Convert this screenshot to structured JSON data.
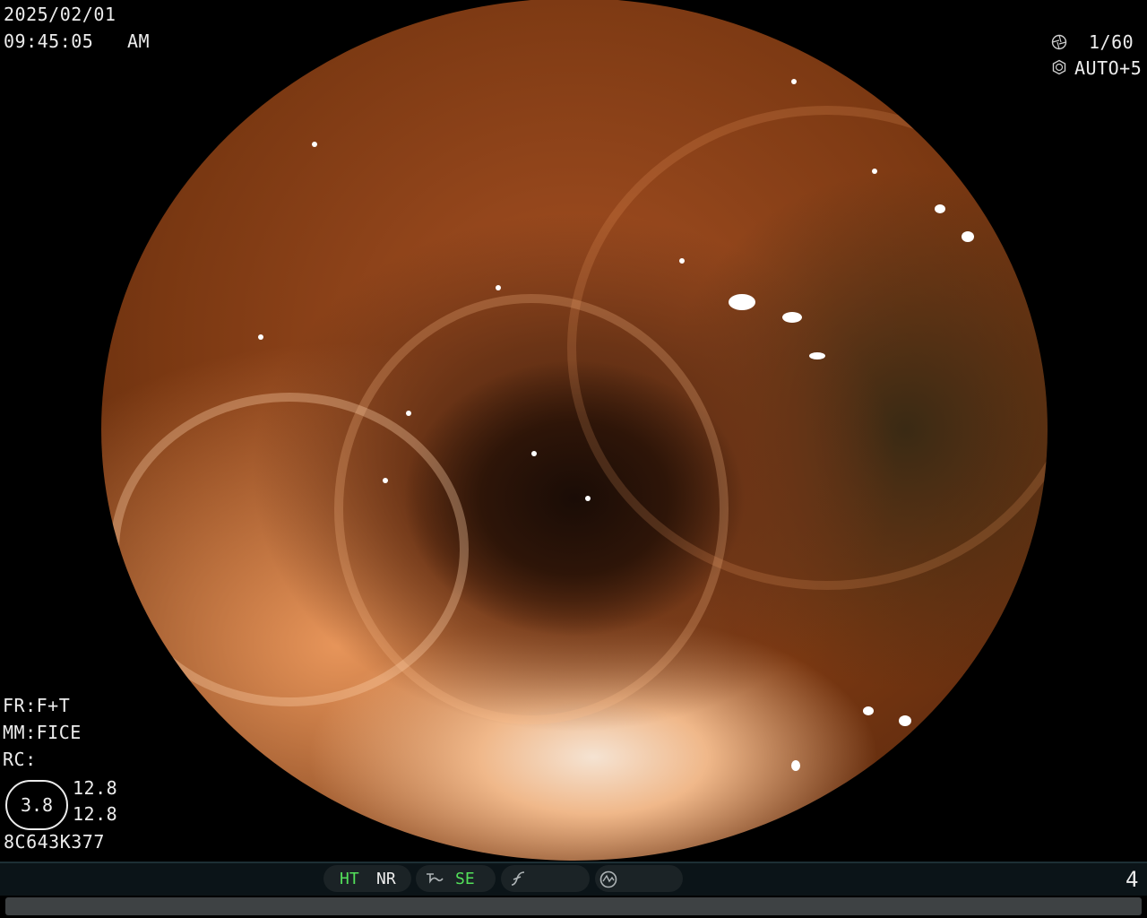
{
  "osd": {
    "date": "2025/02/01",
    "time": "09:45:05   AM",
    "shutter": "1/60",
    "auto": "AUTO+5",
    "fr": "FR:F+T",
    "mm": "MM:FICE",
    "rc": "RC:",
    "meter_value": "3.8",
    "meter_top": "12.8",
    "meter_bottom": "12.8",
    "serial": "8C643K377"
  },
  "icons": {
    "shutter": "aperture-icon",
    "auto": "exposure-icon",
    "structure": "structure-enhance-icon",
    "color": "color-tone-icon",
    "scope": "scope-status-icon"
  },
  "statusbar": {
    "ht": "HT",
    "nr": "NR",
    "se": "SE",
    "page": "4",
    "accent_color": "#53e05a",
    "background_color": "#0b1418"
  }
}
